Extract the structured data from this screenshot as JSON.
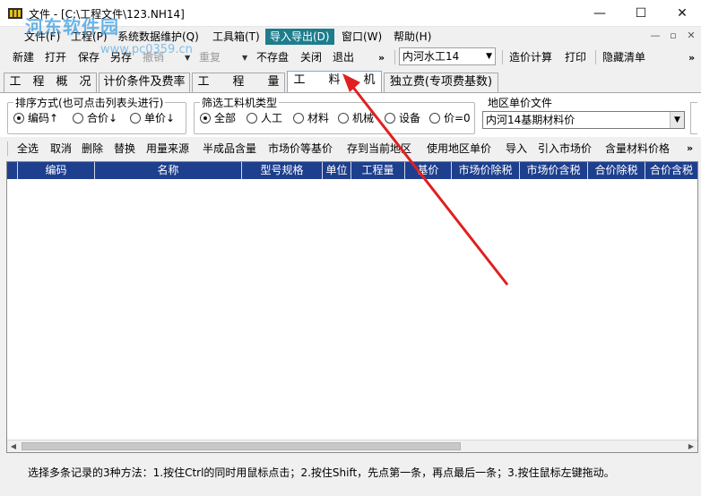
{
  "window": {
    "title": "文件 - [C:\\工程文件\\123.NH14]",
    "min_icon": "—",
    "max_icon": "☐",
    "close_icon": "✕"
  },
  "menu": {
    "items": [
      "文件(F)",
      "工程(P)",
      "系统数据维护(Q)",
      "工具箱(T)",
      "导入导出(D)",
      "窗口(W)",
      "帮助(H)"
    ],
    "active_index": 4,
    "mdi_buttons": [
      "—",
      "▫",
      "✕"
    ]
  },
  "toolbar": {
    "buttons": [
      "新建",
      "打开",
      "保存",
      "另存",
      "撤销",
      "重复",
      "不存盘",
      "关闭",
      "退出"
    ],
    "disabled": [
      "撤销",
      "重复"
    ],
    "combo_value": "内河水工14",
    "right_buttons": [
      "造价计算",
      "打印",
      "隐藏清单"
    ],
    "overflow": "»"
  },
  "tabs": {
    "items": [
      "工　程　概　况",
      "计价条件及费率",
      "工　　程　　量",
      "工　　料　　机",
      "独立费(专项费基数)"
    ],
    "active_index": 3
  },
  "sort_group": {
    "label": "排序方式(也可点击列表头进行)",
    "options": [
      "编码↑",
      "合价↓",
      "单价↓"
    ],
    "checked_index": 0
  },
  "type_group": {
    "label": "筛选工料机类型",
    "options": [
      "全部",
      "人工",
      "材料",
      "机械",
      "设备",
      "价=0"
    ],
    "checked_index": 0
  },
  "region_group": {
    "label": "地区单价文件",
    "value": "内河14基期材料价"
  },
  "actions": {
    "items": [
      "全选",
      "取消",
      "删除",
      "替换",
      "用量来源",
      "半成品含量",
      "市场价等基价",
      "存到当前地区",
      "使用地区单价",
      "导入",
      "引入市场价",
      "含量材料价格"
    ],
    "overflow": "»"
  },
  "grid": {
    "columns": [
      "编码",
      "名称",
      "型号规格",
      "单位",
      "工程量",
      "基价",
      "市场价除税",
      "市场价含税",
      "合价除税",
      "合价含税"
    ],
    "rows": []
  },
  "status": {
    "text": "选择多条记录的3种方法：1.按住Ctrl的同时用鼠标点击；2.按住Shift，先点第一条，再点最后一条；3.按住鼠标左键拖动。"
  },
  "watermark": {
    "title": "河东软件园",
    "url": "www.pc0359.cn"
  },
  "colors": {
    "accent": "#1e7d8c",
    "grid_header": "#1e3f8e",
    "arrow": "#e02020"
  }
}
